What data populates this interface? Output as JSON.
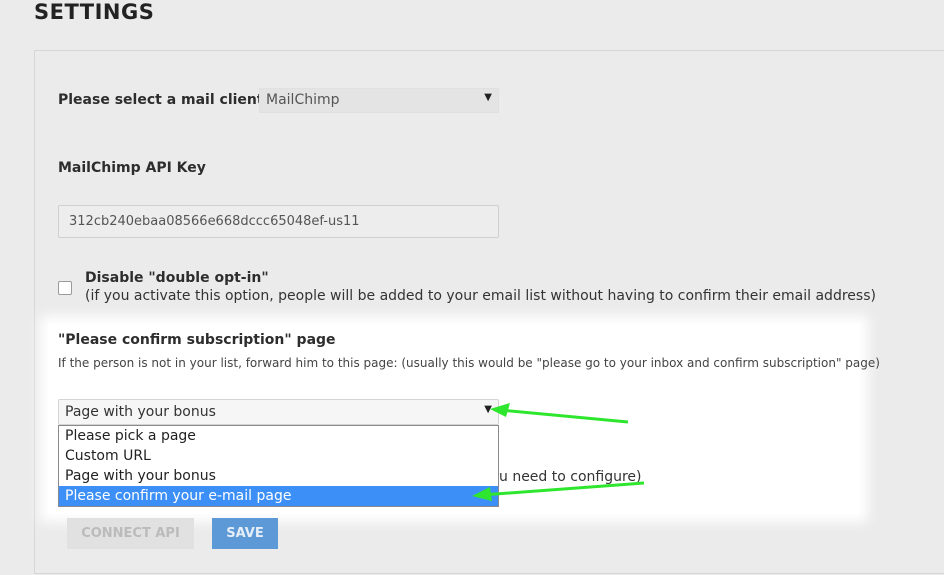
{
  "page": {
    "title": "SETTINGS"
  },
  "mail_client": {
    "label": "Please select a mail client",
    "selected": "MailChimp"
  },
  "api_key": {
    "label": "MailChimp API Key",
    "value": "312cb240ebaa08566e668dccc65048ef-us11"
  },
  "double_optin": {
    "title": "Disable \"double opt-in\"",
    "description": "(if you activate this option, people will be added to your email list without having to confirm their email address)",
    "checked": false
  },
  "confirm_page": {
    "title": "\"Please confirm subscription\" page",
    "description": "If the person is not in your list, forward him to this page: (usually this would be \"please go to your inbox and confirm subscription\" page)",
    "selected": "Page with your bonus",
    "options": [
      "Please pick a page",
      "Custom URL",
      "Page with your bonus",
      "Please confirm your e-mail page"
    ],
    "highlighted_option": "Please confirm your e-mail page"
  },
  "partial_text": "u need to configure)",
  "buttons": {
    "connect_api": "CONNECT API",
    "save": "SAVE"
  },
  "colors": {
    "accent_blue": "#3b8ff6",
    "save_button": "#5d99d6",
    "arrow_green": "#2ee62e"
  },
  "icons": {
    "dropdown_caret": "caret-down-icon",
    "annotation_arrow": "green-arrow-icon"
  }
}
